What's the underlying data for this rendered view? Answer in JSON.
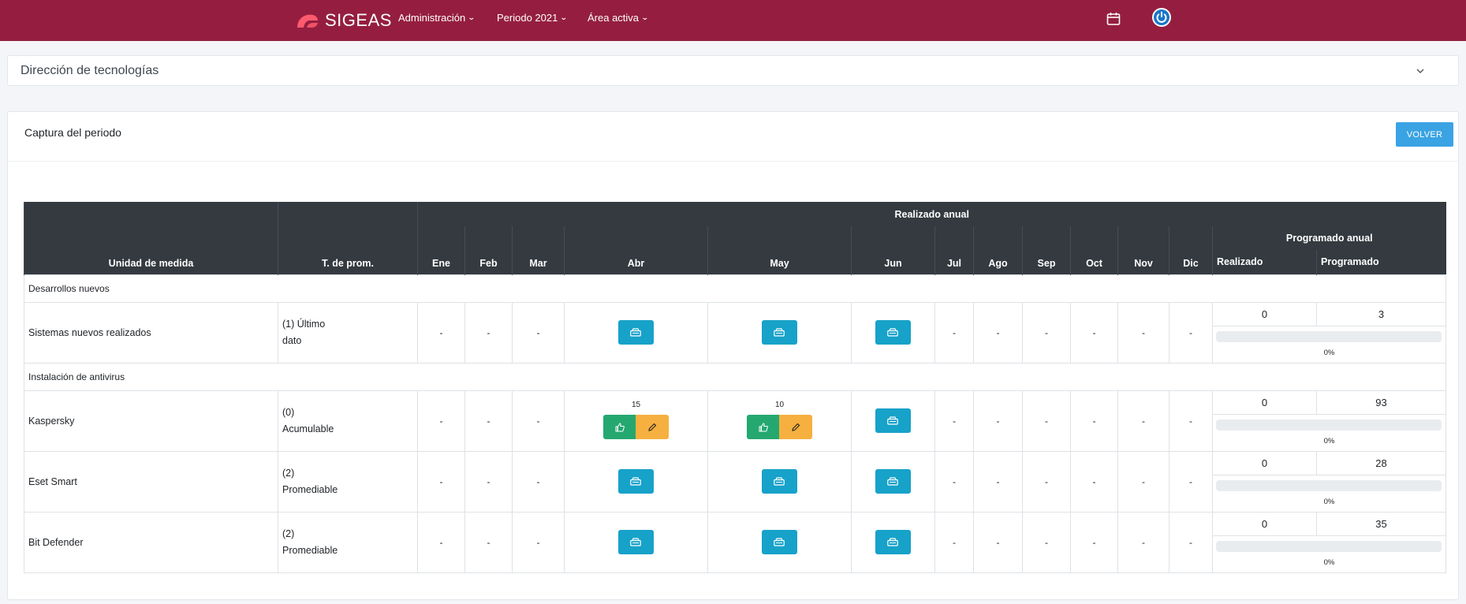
{
  "nav": {
    "brand": "SIGEAS",
    "menu": [
      {
        "label": "Administración"
      },
      {
        "label": "Periodo 2021"
      },
      {
        "label": "Área activa"
      }
    ],
    "icons": [
      "calendar-icon",
      "power-icon"
    ]
  },
  "area": {
    "title": "Dirección de tecnologías"
  },
  "main": {
    "title": "Captura del periodo",
    "back_label": "VOLVER"
  },
  "table": {
    "headers": {
      "unit": "Unidad de medida",
      "tprom": "T. de prom.",
      "realizado_anual": "Realizado anual",
      "programado_anual": "Programado anual",
      "months": [
        "Ene",
        "Feb",
        "Mar",
        "Abr",
        "May",
        "Jun",
        "Jul",
        "Ago",
        "Sep",
        "Oct",
        "Nov",
        "Dic"
      ],
      "realizado": "Realizado",
      "programado": "Programado"
    },
    "groups": [
      {
        "name": "Desarrollos nuevos",
        "rows": [
          {
            "name": "Sistemas nuevos realizados",
            "tprom_1": "(1) Último",
            "tprom_2": "dato",
            "months": [
              "-",
              "-",
              "-",
              "btn",
              "btn",
              "btn",
              "-",
              "-",
              "-",
              "-",
              "-",
              "-"
            ],
            "realizado": "0",
            "programado": "3",
            "progress_pct": "0%",
            "progress": 0
          }
        ]
      },
      {
        "name": "Instalación de antivirus",
        "rows": [
          {
            "name": "Kaspersky",
            "tprom_1": "(0)",
            "tprom_2": "Acumulable",
            "months": [
              "-",
              "-",
              "-",
              "15",
              "10",
              "btn",
              "-",
              "-",
              "-",
              "-",
              "-",
              "-"
            ],
            "realizado": "0",
            "programado": "93",
            "progress_pct": "0%",
            "progress": 0
          },
          {
            "name": "Eset Smart",
            "tprom_1": "(2)",
            "tprom_2": "Promediable",
            "months": [
              "-",
              "-",
              "-",
              "btn",
              "btn",
              "btn",
              "-",
              "-",
              "-",
              "-",
              "-",
              "-"
            ],
            "realizado": "0",
            "programado": "28",
            "progress_pct": "0%",
            "progress": 0
          },
          {
            "name": "Bit Defender",
            "tprom_1": "(2)",
            "tprom_2": "Promediable",
            "months": [
              "-",
              "-",
              "-",
              "btn",
              "btn",
              "btn",
              "-",
              "-",
              "-",
              "-",
              "-",
              "-"
            ],
            "realizado": "0",
            "programado": "35",
            "progress_pct": "0%",
            "progress": 0
          }
        ]
      }
    ]
  },
  "colors": {
    "navbar": "#951e40",
    "capture_button": "#17a2c9",
    "approve_button": "#24a870",
    "edit_button": "#f5b03f",
    "volver_button": "#3aa3e3",
    "table_header": "#343a40"
  }
}
